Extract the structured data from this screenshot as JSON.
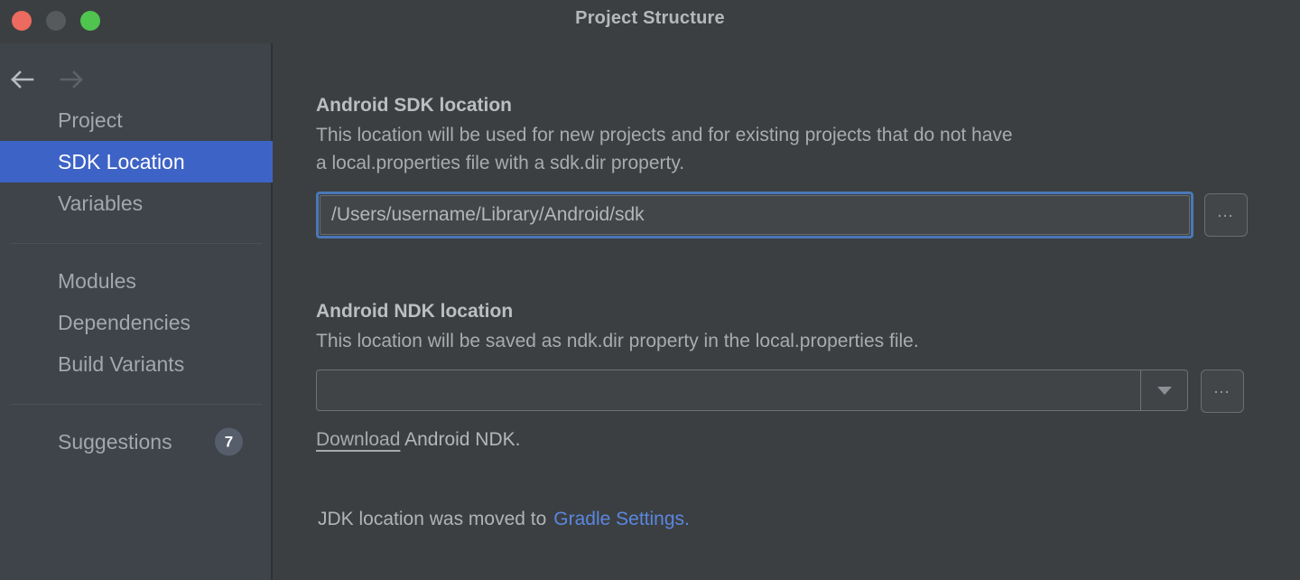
{
  "window": {
    "title": "Project Structure",
    "traffic_lights": [
      "close",
      "minimize",
      "zoom"
    ],
    "colors": {
      "titlebar_bg": "#3c3f41",
      "sidebar_bg": "#3f434a",
      "main_bg": "#3c3f41",
      "selection_blue": "#3d63c6",
      "focus_ring_blue": "#4a78b8",
      "link_blue": "#5a87e0",
      "close_red": "#ec6a5f",
      "minimize_grey": "#565a5c",
      "zoom_green": "#4fc44f"
    }
  },
  "sidebar": {
    "back_icon": "arrow-left-icon",
    "forward_icon": "arrow-right-icon",
    "items": [
      {
        "label": "Project",
        "selected": false
      },
      {
        "label": "SDK Location",
        "selected": true
      },
      {
        "label": "Variables",
        "selected": false
      },
      {
        "label": "Modules",
        "selected": false
      },
      {
        "label": "Dependencies",
        "selected": false
      },
      {
        "label": "Build Variants",
        "selected": false
      },
      {
        "label": "Suggestions",
        "selected": false,
        "badge": "7"
      }
    ]
  },
  "main": {
    "sdk": {
      "title": "Android SDK location",
      "description": "This location will be used for new projects and for existing projects that do not have\na local.properties file with a sdk.dir property.",
      "input_value": "/Users/username/Library/Android/sdk",
      "input_placeholder": "",
      "browse_label": "…",
      "browse_icon": "ellipsis-icon"
    },
    "ndk": {
      "title": "Android NDK location",
      "description": "This location will be saved as ndk.dir property in the local.properties file.",
      "combo_value": "",
      "combo_placeholder": "",
      "dropdown_icon": "chevron-down-icon",
      "browse_label": "…",
      "browse_icon": "ellipsis-icon",
      "download_link_text": "Download",
      "download_rest_text": " Android NDK."
    },
    "jdk_note": {
      "text": "JDK location was moved to",
      "link_text": "Gradle Settings."
    }
  }
}
